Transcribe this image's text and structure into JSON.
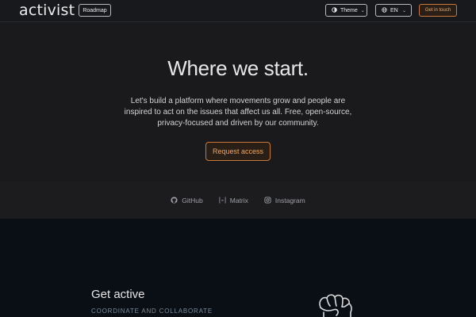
{
  "header": {
    "logo": "activist",
    "roadmap_label": "Roadmap",
    "theme_label": "Theme",
    "language_label": "EN",
    "contact_label": "Get in touch"
  },
  "hero": {
    "title": "Where we start.",
    "text": "Let's build a platform where movements grow and people are inspired to act on the issues that affect us all. Free, open-source, privacy-focused and driven by our community.",
    "cta_label": "Request access"
  },
  "socials": [
    {
      "label": "GitHub",
      "icon": "github-icon"
    },
    {
      "label": "Matrix",
      "icon": "matrix-icon"
    },
    {
      "label": "Instagram",
      "icon": "instagram-icon"
    }
  ],
  "get_active": {
    "title": "Get active",
    "subtitle": "COORDINATE AND COLLABORATE"
  },
  "colors": {
    "accent": "#f0a766",
    "header_bg": "#18191c",
    "hero_bg": "#1a1a1c",
    "section_bg": "#0a0e15"
  }
}
